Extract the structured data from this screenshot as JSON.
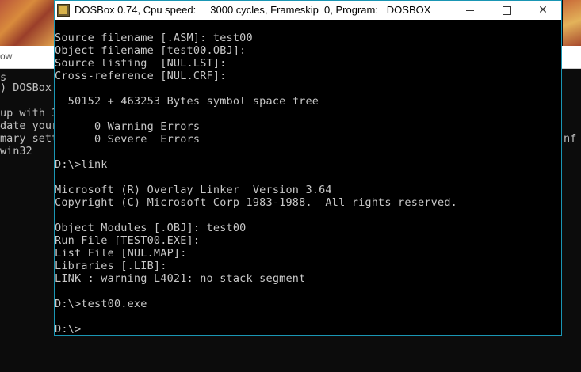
{
  "background": {
    "title_partial": "ow",
    "left_lines": [
      "s",
      ") DOSBox 7",
      "",
      "up with 3",
      "date your",
      "mary sett",
      "win32"
    ],
    "right_fragment": "nf"
  },
  "dosbox": {
    "title": "DOSBox 0.74, Cpu speed:     3000 cycles, Frameskip  0, Program:   DOSBOX",
    "minimize": "",
    "maximize": "",
    "close": "✕",
    "lines": [
      "Source filename [.ASM]: test00",
      "Object filename [test00.OBJ]:",
      "Source listing  [NUL.LST]:",
      "Cross-reference [NUL.CRF]:",
      "",
      "  50152 + 463253 Bytes symbol space free",
      "",
      "      0 Warning Errors",
      "      0 Severe  Errors",
      "",
      "D:\\>link",
      "",
      "Microsoft (R) Overlay Linker  Version 3.64",
      "Copyright (C) Microsoft Corp 1983-1988.  All rights reserved.",
      "",
      "Object Modules [.OBJ]: test00",
      "Run File [TEST00.EXE]:",
      "List File [NUL.MAP]:",
      "Libraries [.LIB]:",
      "LINK : warning L4021: no stack segment",
      "",
      "D:\\>test00.exe",
      "",
      "D:\\>"
    ]
  }
}
